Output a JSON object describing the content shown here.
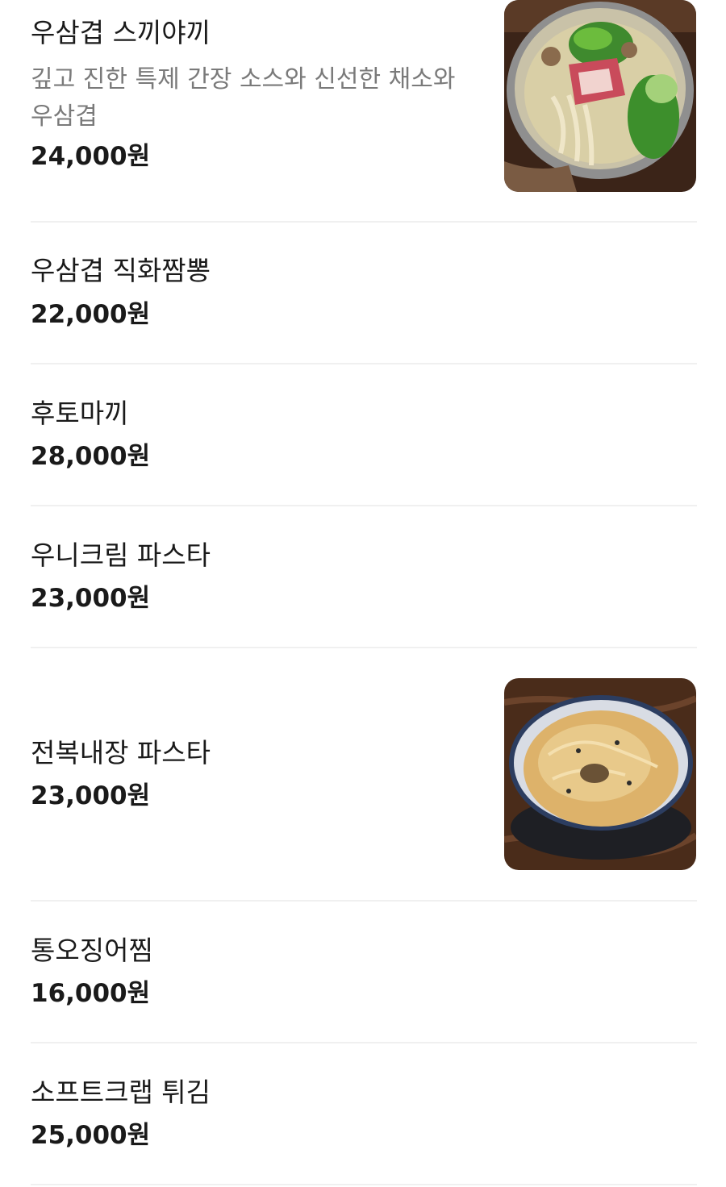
{
  "menu": {
    "items": [
      {
        "name": "우삼겹 스끼야끼",
        "description": "깊고 진한 특제 간장 소스와 신선한 채소와 우삼겹",
        "price": "24,000원",
        "image": "sukiyaki-hotpot-photo"
      },
      {
        "name": "우삼겹 직화짬뽕",
        "price": "22,000원"
      },
      {
        "name": "후토마끼",
        "price": "28,000원"
      },
      {
        "name": "우니크림 파스타",
        "price": "23,000원"
      },
      {
        "name": "전복내장 파스타",
        "price": "23,000원",
        "image": "abalone-cream-pasta-photo"
      },
      {
        "name": "통오징어찜",
        "price": "16,000원"
      },
      {
        "name": "소프트크랩 튀김",
        "price": "25,000원"
      }
    ]
  }
}
